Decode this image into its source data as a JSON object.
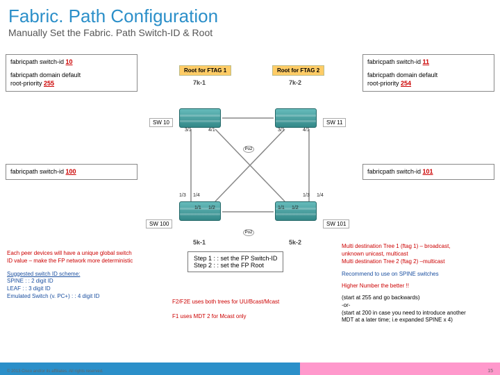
{
  "header": {
    "title": "Fabric. Path Configuration",
    "subtitle": "Manually Set the Fabric. Path Switch-ID & Root"
  },
  "cfg": {
    "sw10_line1_pre": "fabricpath switch-id ",
    "sw10_line1_val": "10",
    "sw10_line2_pre": "fabricpath domain default",
    "sw10_line3_pre": "  root-priority ",
    "sw10_line3_val": "255",
    "sw11_line1_pre": "fabricpath switch-id ",
    "sw11_line1_val": "11",
    "sw11_line2_pre": "fabricpath domain default",
    "sw11_line3_pre": "  root-priority ",
    "sw11_line3_val": "254",
    "sw100_line1_pre": "fabricpath switch-id ",
    "sw100_line1_val": "100",
    "sw101_line1_pre": "fabricpath switch-id ",
    "sw101_line1_val": "101"
  },
  "roots": {
    "ftag1": "Root for FTAG 1",
    "ftag2": "Root for FTAG 2"
  },
  "swlabels": {
    "sw10": "SW 10",
    "sw11": "SW 11",
    "sw100": "SW 100",
    "sw101": "SW 101"
  },
  "devices": {
    "d7k1": "7k-1",
    "d7k2": "7k-2",
    "d5k1": "5k-1",
    "d5k2": "5k-2"
  },
  "ports": {
    "p31a": "3/1",
    "p41a": "4/1",
    "p31b": "3/1",
    "p41b": "4/1",
    "p13a": "1/3",
    "p11a": "1/1",
    "p12a": "1/2",
    "p14a": "1/4",
    "p11b": "1/1",
    "p12b": "1/2",
    "p13b": "1/3",
    "p14b": "1/4"
  },
  "po": {
    "po2a": "Po2",
    "po2b": "Po2"
  },
  "steps": {
    "s1": "Step 1 : : set the FP Switch-ID",
    "s2": "Step 2 : : set the FP Root"
  },
  "notes_left": {
    "l1": "Each peer devices will have a unique global switch",
    "l2": "ID value – make the FP network more deterministic",
    "l3": "Suggested switch ID scheme:",
    "l4": "SPINE : : 2 digit ID",
    "l5": "LEAF : : 3 digit ID",
    "l6": "Emulated Switch (v. PC+) : : 4 digit ID"
  },
  "notes_right": {
    "r1": "Multi destination Tree 1 (ftag 1) – broadcast,",
    "r2": "unknown unicast, multicast",
    "r3": "Multi destination Tree 2 (ftag 2) –multicast",
    "r4": "Recommend to use on SPINE switches",
    "r5": "Higher Number the better !!",
    "r6a": "(start at 255 and go backwards)",
    "r6b": "-or-",
    "r6c": "(start at 200 in case you need to introduce another",
    "r6d": "MDT at a later time; i.e expanded SPINE x 4)"
  },
  "notes_mid": {
    "m1": "F2/F2E uses both trees for UU/Bcast/Mcast",
    "m2": "F1 uses MDT 2 for Mcast only"
  },
  "footer": {
    "copy": "© 2013 Cisco and/or its affiliates. All rights reserved.",
    "page": "15"
  }
}
